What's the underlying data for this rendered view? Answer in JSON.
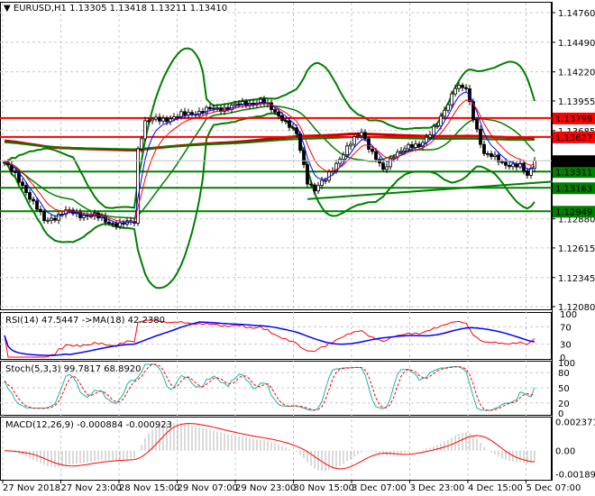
{
  "header": {
    "symbol": "EURUSD,H1",
    "open": "1.13305",
    "high": "1.13418",
    "low": "1.13211",
    "close": "1.13410"
  },
  "chart_data": {
    "type": "candlestick",
    "bars": 148,
    "close_path": [
      [
        0,
        1.13395
      ],
      [
        5,
        1.1319
      ],
      [
        11,
        1.1286
      ],
      [
        17,
        1.12943
      ],
      [
        25,
        1.12902
      ],
      [
        32,
        1.1282
      ],
      [
        36,
        1.1286
      ],
      [
        37,
        1.13519
      ],
      [
        39,
        1.13765
      ],
      [
        47,
        1.13806
      ],
      [
        52,
        1.13847
      ],
      [
        60,
        1.13889
      ],
      [
        71,
        1.13954
      ],
      [
        77,
        1.13806
      ],
      [
        81,
        1.13642
      ],
      [
        84,
        1.13231
      ],
      [
        86,
        1.13149
      ],
      [
        89,
        1.13231
      ],
      [
        92,
        1.13395
      ],
      [
        99,
        1.13683
      ],
      [
        102,
        1.13478
      ],
      [
        105,
        1.13313
      ],
      [
        108,
        1.13478
      ],
      [
        115,
        1.1356
      ],
      [
        120,
        1.13724
      ],
      [
        125,
        1.14094
      ],
      [
        128,
        1.14053
      ],
      [
        130,
        1.13806
      ],
      [
        133,
        1.13478
      ],
      [
        138,
        1.13395
      ],
      [
        143,
        1.13354
      ],
      [
        145,
        1.13272
      ],
      [
        147,
        1.1341
      ]
    ],
    "price_axis": [
      "1.14760",
      "1.14490",
      "1.14220",
      "1.13955",
      "1.13685",
      "1.12880",
      "1.12615",
      "1.12345",
      "1.12080"
    ],
    "price_range": [
      1.1208,
      1.1476
    ],
    "levels": [
      {
        "price": 1.13799,
        "label": "1.13799",
        "color": "#ff0000"
      },
      {
        "price": 1.13627,
        "label": "1.13627",
        "color": "#ff0000"
      },
      {
        "price": 1.13311,
        "label": "1.13311",
        "color": "#007f00"
      },
      {
        "price": 1.13163,
        "label": "1.13163",
        "color": "#007f00"
      },
      {
        "price": 1.12949,
        "label": "1.12949",
        "color": "#007f00"
      }
    ],
    "trendline": {
      "from": [
        84,
        1.1306
      ],
      "to": [
        152,
        1.1322
      ],
      "color": "#007f00"
    },
    "current_price": {
      "price": 1.1341,
      "label": "1.13410"
    },
    "time_labels": [
      "27 Nov 2018",
      "27 Nov 23:00",
      "28 Nov 15:00",
      "29 Nov 07:00",
      "29 Nov 23:00",
      "30 Nov 15:00",
      "3 Dec 07:00",
      "3 Dec 23:00",
      "4 Dec 15:00",
      "5 Dec 07:00"
    ],
    "rsi": {
      "title": "RSI(14) 47.5447  ->MA(18) 42.2380",
      "levels": [
        "100",
        "70",
        "30",
        "0"
      ]
    },
    "stoch": {
      "title": "Stoch(5,3,3) 99.7817 68.8920",
      "levels": [
        "100",
        "80",
        "50",
        "20",
        "0"
      ]
    },
    "macd": {
      "title": "MACD(12,26,9) -0.000884 -0.000923",
      "levels": [
        "0.002371",
        "0.00",
        "-0.00189"
      ],
      "range": [
        -0.0023,
        0.0027
      ]
    }
  }
}
